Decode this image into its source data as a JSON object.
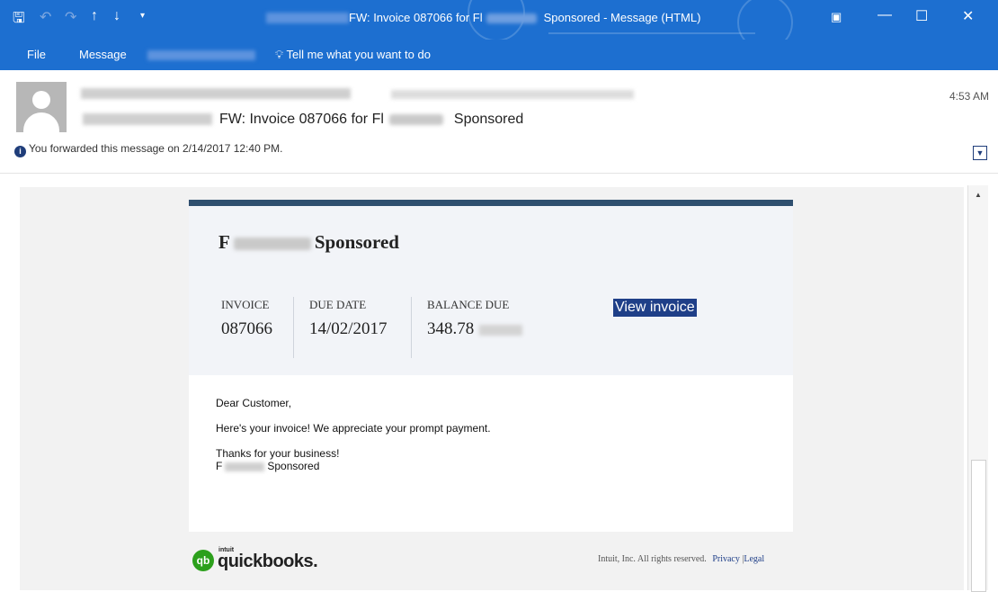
{
  "window": {
    "title_subject": "FW: Invoice 087066 for Fl",
    "title_suffix": "Sponsored  -  Message (HTML)"
  },
  "quick_access": {
    "save_icon": "save-icon",
    "undo_icon": "undo-icon",
    "redo_icon": "redo-icon",
    "up_icon": "arrow-up-icon",
    "down_icon": "arrow-down-icon",
    "customize_icon": "customize-qat-icon"
  },
  "menu": {
    "file": "File",
    "message": "Message",
    "tell_me": "Tell me what you want to do"
  },
  "header": {
    "time": "4:53 AM",
    "subject_main": "FW: Invoice 087066 for Fl",
    "subject_end": "Sponsored",
    "forwarded_info": "You forwarded this message on 2/14/2017 12:40 PM."
  },
  "invoice": {
    "company_initial": "F",
    "company_suffix": "Sponsored",
    "invoice_label": "INVOICE",
    "invoice_number": "087066",
    "due_label": "DUE DATE",
    "due_date": "14/02/2017",
    "balance_label": "BALANCE DUE",
    "balance_amount": "348.78",
    "view_button": "View invoice"
  },
  "message": {
    "greeting": "Dear Customer,",
    "line1": "Here's your invoice! We appreciate your prompt payment.",
    "thanks": "Thanks for your business!",
    "sig_initial": "F",
    "sig_suffix": "Sponsored"
  },
  "footer": {
    "logo_prefix": "intuit",
    "logo_mark": "qb",
    "logo_word": "quickbooks.",
    "rights": "Intuit, Inc. All rights reserved.",
    "privacy": "Privacy",
    "separator": "|",
    "legal": "Legal"
  },
  "colors": {
    "titlebar": "#1d6fd0",
    "banner": "#2f4f6f",
    "button": "#1f3f88",
    "quickbooks_green": "#2ca01c"
  }
}
